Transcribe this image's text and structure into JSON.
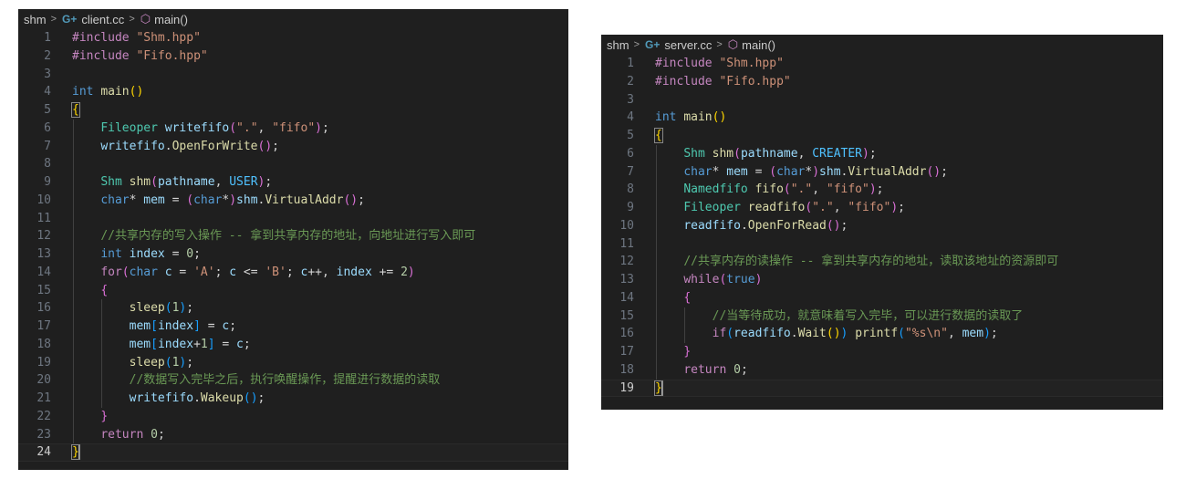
{
  "left": {
    "breadcrumb": {
      "folder": "shm",
      "file": "client.cc",
      "symbol": "main()"
    },
    "lines": [
      {
        "n": "1",
        "t": [
          [
            "pp",
            "#include "
          ],
          [
            "str",
            "\"Shm.hpp\""
          ]
        ]
      },
      {
        "n": "2",
        "t": [
          [
            "pp",
            "#include "
          ],
          [
            "str",
            "\"Fifo.hpp\""
          ]
        ]
      },
      {
        "n": "3",
        "t": []
      },
      {
        "n": "4",
        "t": [
          [
            "kw",
            "int "
          ],
          [
            "fn",
            "main"
          ],
          [
            "b1",
            "()"
          ]
        ]
      },
      {
        "n": "5",
        "t": [
          [
            "b1 boxbr",
            "{"
          ]
        ]
      },
      {
        "n": "6",
        "t": [
          [
            "op",
            "    "
          ],
          [
            "ty",
            "Fileoper "
          ],
          [
            "id",
            "writefifo"
          ],
          [
            "b2",
            "("
          ],
          [
            "str",
            "\".\""
          ],
          [
            "op",
            ", "
          ],
          [
            "str",
            "\"fifo\""
          ],
          [
            "b2",
            ")"
          ],
          [
            "op",
            ";"
          ]
        ]
      },
      {
        "n": "7",
        "t": [
          [
            "op",
            "    "
          ],
          [
            "id",
            "writefifo"
          ],
          [
            "op",
            "."
          ],
          [
            "fn",
            "OpenForWrite"
          ],
          [
            "b2",
            "()"
          ],
          [
            "op",
            ";"
          ]
        ]
      },
      {
        "n": "8",
        "t": []
      },
      {
        "n": "9",
        "t": [
          [
            "op",
            "    "
          ],
          [
            "ty",
            "Shm "
          ],
          [
            "fn",
            "shm"
          ],
          [
            "b2",
            "("
          ],
          [
            "id",
            "pathname"
          ],
          [
            "op",
            ", "
          ],
          [
            "en",
            "USER"
          ],
          [
            "b2",
            ")"
          ],
          [
            "op",
            ";"
          ]
        ]
      },
      {
        "n": "10",
        "t": [
          [
            "op",
            "    "
          ],
          [
            "kw",
            "char"
          ],
          [
            "op",
            "* "
          ],
          [
            "id",
            "mem"
          ],
          [
            "op",
            " = "
          ],
          [
            "b2",
            "("
          ],
          [
            "kw",
            "char"
          ],
          [
            "op",
            "*"
          ],
          [
            "b2",
            ")"
          ],
          [
            "id",
            "shm"
          ],
          [
            "op",
            "."
          ],
          [
            "fn",
            "VirtualAddr"
          ],
          [
            "b2",
            "()"
          ],
          [
            "op",
            ";"
          ]
        ]
      },
      {
        "n": "11",
        "t": []
      },
      {
        "n": "12",
        "t": [
          [
            "op",
            "    "
          ],
          [
            "cm",
            "//共享内存的写入操作 -- 拿到共享内存的地址，向地址进行写入即可"
          ]
        ]
      },
      {
        "n": "13",
        "t": [
          [
            "op",
            "    "
          ],
          [
            "kw",
            "int "
          ],
          [
            "id",
            "index"
          ],
          [
            "op",
            " = "
          ],
          [
            "num",
            "0"
          ],
          [
            "op",
            ";"
          ]
        ]
      },
      {
        "n": "14",
        "t": [
          [
            "op",
            "    "
          ],
          [
            "ctrl",
            "for"
          ],
          [
            "b2",
            "("
          ],
          [
            "kw",
            "char "
          ],
          [
            "id",
            "c"
          ],
          [
            "op",
            " = "
          ],
          [
            "str",
            "'A'"
          ],
          [
            "op",
            "; "
          ],
          [
            "id",
            "c"
          ],
          [
            "op",
            " <= "
          ],
          [
            "str",
            "'B'"
          ],
          [
            "op",
            "; "
          ],
          [
            "id",
            "c"
          ],
          [
            "op",
            "++, "
          ],
          [
            "id",
            "index"
          ],
          [
            "op",
            " += "
          ],
          [
            "num",
            "2"
          ],
          [
            "b2",
            ")"
          ]
        ]
      },
      {
        "n": "15",
        "t": [
          [
            "op",
            "    "
          ],
          [
            "b2",
            "{"
          ]
        ]
      },
      {
        "n": "16",
        "t": [
          [
            "op",
            "        "
          ],
          [
            "fn",
            "sleep"
          ],
          [
            "b3",
            "("
          ],
          [
            "num",
            "1"
          ],
          [
            "b3",
            ")"
          ],
          [
            "op",
            ";"
          ]
        ]
      },
      {
        "n": "17",
        "t": [
          [
            "op",
            "        "
          ],
          [
            "id",
            "mem"
          ],
          [
            "b3",
            "["
          ],
          [
            "id",
            "index"
          ],
          [
            "b3",
            "]"
          ],
          [
            "op",
            " = "
          ],
          [
            "id",
            "c"
          ],
          [
            "op",
            ";"
          ]
        ]
      },
      {
        "n": "18",
        "t": [
          [
            "op",
            "        "
          ],
          [
            "id",
            "mem"
          ],
          [
            "b3",
            "["
          ],
          [
            "id",
            "index"
          ],
          [
            "op",
            "+"
          ],
          [
            "num",
            "1"
          ],
          [
            "b3",
            "]"
          ],
          [
            "op",
            " = "
          ],
          [
            "id",
            "c"
          ],
          [
            "op",
            ";"
          ]
        ]
      },
      {
        "n": "19",
        "t": [
          [
            "op",
            "        "
          ],
          [
            "fn",
            "sleep"
          ],
          [
            "b3",
            "("
          ],
          [
            "num",
            "1"
          ],
          [
            "b3",
            ")"
          ],
          [
            "op",
            ";"
          ]
        ]
      },
      {
        "n": "20",
        "t": [
          [
            "op",
            "        "
          ],
          [
            "cm",
            "//数据写入完毕之后，执行唤醒操作，提醒进行数据的读取"
          ]
        ]
      },
      {
        "n": "21",
        "t": [
          [
            "op",
            "        "
          ],
          [
            "id",
            "writefifo"
          ],
          [
            "op",
            "."
          ],
          [
            "fn",
            "Wakeup"
          ],
          [
            "b3",
            "()"
          ],
          [
            "op",
            ";"
          ]
        ]
      },
      {
        "n": "22",
        "t": [
          [
            "op",
            "    "
          ],
          [
            "b2",
            "}"
          ]
        ]
      },
      {
        "n": "23",
        "t": [
          [
            "op",
            "    "
          ],
          [
            "ctrl",
            "return "
          ],
          [
            "num",
            "0"
          ],
          [
            "op",
            ";"
          ]
        ]
      },
      {
        "n": "24",
        "t": [
          [
            "b1 boxbr",
            "}"
          ]
        ],
        "current": true
      }
    ]
  },
  "right": {
    "breadcrumb": {
      "folder": "shm",
      "file": "server.cc",
      "symbol": "main()"
    },
    "lines": [
      {
        "n": "1",
        "t": [
          [
            "pp",
            "#include "
          ],
          [
            "str",
            "\"Shm.hpp\""
          ]
        ]
      },
      {
        "n": "2",
        "t": [
          [
            "pp",
            "#include "
          ],
          [
            "str",
            "\"Fifo.hpp\""
          ]
        ]
      },
      {
        "n": "3",
        "t": []
      },
      {
        "n": "4",
        "t": [
          [
            "kw",
            "int "
          ],
          [
            "fn",
            "main"
          ],
          [
            "b1",
            "()"
          ]
        ]
      },
      {
        "n": "5",
        "t": [
          [
            "b1 boxbr",
            "{"
          ]
        ]
      },
      {
        "n": "6",
        "t": [
          [
            "op",
            "    "
          ],
          [
            "ty",
            "Shm "
          ],
          [
            "fn",
            "shm"
          ],
          [
            "b2",
            "("
          ],
          [
            "id",
            "pathname"
          ],
          [
            "op",
            ", "
          ],
          [
            "en",
            "CREATER"
          ],
          [
            "b2",
            ")"
          ],
          [
            "op",
            ";"
          ]
        ]
      },
      {
        "n": "7",
        "t": [
          [
            "op",
            "    "
          ],
          [
            "kw",
            "char"
          ],
          [
            "op",
            "* "
          ],
          [
            "id",
            "mem"
          ],
          [
            "op",
            " = "
          ],
          [
            "b2",
            "("
          ],
          [
            "kw",
            "char"
          ],
          [
            "op",
            "*"
          ],
          [
            "b2",
            ")"
          ],
          [
            "id",
            "shm"
          ],
          [
            "op",
            "."
          ],
          [
            "fn",
            "VirtualAddr"
          ],
          [
            "b2",
            "()"
          ],
          [
            "op",
            ";"
          ]
        ]
      },
      {
        "n": "8",
        "t": [
          [
            "op",
            "    "
          ],
          [
            "ty",
            "Namedfifo "
          ],
          [
            "fn",
            "fifo"
          ],
          [
            "b2",
            "("
          ],
          [
            "str",
            "\".\""
          ],
          [
            "op",
            ", "
          ],
          [
            "str",
            "\"fifo\""
          ],
          [
            "b2",
            ")"
          ],
          [
            "op",
            ";"
          ]
        ]
      },
      {
        "n": "9",
        "t": [
          [
            "op",
            "    "
          ],
          [
            "ty",
            "Fileoper "
          ],
          [
            "fn",
            "readfifo"
          ],
          [
            "b2",
            "("
          ],
          [
            "str",
            "\".\""
          ],
          [
            "op",
            ", "
          ],
          [
            "str",
            "\"fifo\""
          ],
          [
            "b2",
            ")"
          ],
          [
            "op",
            ";"
          ]
        ]
      },
      {
        "n": "10",
        "t": [
          [
            "op",
            "    "
          ],
          [
            "id",
            "readfifo"
          ],
          [
            "op",
            "."
          ],
          [
            "fn",
            "OpenForRead"
          ],
          [
            "b2",
            "()"
          ],
          [
            "op",
            ";"
          ]
        ]
      },
      {
        "n": "11",
        "t": []
      },
      {
        "n": "12",
        "t": [
          [
            "op",
            "    "
          ],
          [
            "cm",
            "//共享内存的读操作 -- 拿到共享内存的地址，读取该地址的资源即可"
          ]
        ]
      },
      {
        "n": "13",
        "t": [
          [
            "op",
            "    "
          ],
          [
            "ctrl",
            "while"
          ],
          [
            "b2",
            "("
          ],
          [
            "kw",
            "true"
          ],
          [
            "b2",
            ")"
          ]
        ]
      },
      {
        "n": "14",
        "t": [
          [
            "op",
            "    "
          ],
          [
            "b2",
            "{"
          ]
        ]
      },
      {
        "n": "15",
        "t": [
          [
            "op",
            "        "
          ],
          [
            "cm",
            "//当等待成功，就意味着写入完毕，可以进行数据的读取了"
          ]
        ]
      },
      {
        "n": "16",
        "t": [
          [
            "op",
            "        "
          ],
          [
            "ctrl",
            "if"
          ],
          [
            "b3",
            "("
          ],
          [
            "id",
            "readfifo"
          ],
          [
            "op",
            "."
          ],
          [
            "fn",
            "Wait"
          ],
          [
            "b1",
            "()"
          ],
          [
            "b3",
            ")"
          ],
          [
            "op",
            " "
          ],
          [
            "fn",
            "printf"
          ],
          [
            "b3",
            "("
          ],
          [
            "str",
            "\"%s\\n\""
          ],
          [
            "op",
            ", "
          ],
          [
            "id",
            "mem"
          ],
          [
            "b3",
            ")"
          ],
          [
            "op",
            ";"
          ]
        ]
      },
      {
        "n": "17",
        "t": [
          [
            "op",
            "    "
          ],
          [
            "b2",
            "}"
          ]
        ]
      },
      {
        "n": "18",
        "t": [
          [
            "op",
            "    "
          ],
          [
            "ctrl",
            "return "
          ],
          [
            "num",
            "0"
          ],
          [
            "op",
            ";"
          ]
        ]
      },
      {
        "n": "19",
        "t": [
          [
            "b1 boxbr",
            "}"
          ]
        ],
        "current": true
      }
    ]
  }
}
